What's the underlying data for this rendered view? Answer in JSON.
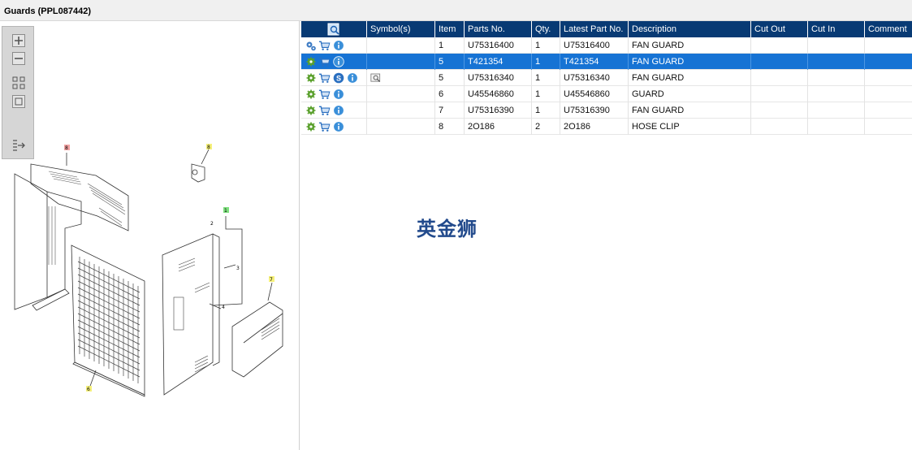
{
  "window": {
    "title": "Guards (PPL087442)"
  },
  "zoom_toolbar": {
    "buttons": [
      "zoom-in-icon",
      "zoom-out-icon",
      "fit-all-icon",
      "fit-page-icon",
      "export-list-icon"
    ]
  },
  "drawing": {
    "callouts": [
      "8",
      "8",
      "1",
      "2",
      "3",
      "4",
      "7",
      "6"
    ]
  },
  "grid": {
    "columns": [
      "",
      "Symbol(s)",
      "Item",
      "Parts No.",
      "Qty.",
      "Latest Part No.",
      "Description",
      "Cut Out",
      "Cut In",
      "Comment"
    ],
    "rows": [
      {
        "item": "1",
        "parts_no": "U75316400",
        "qty": "1",
        "latest": "U75316400",
        "description": "FAN GUARD",
        "cut_out": "",
        "cut_in": "",
        "comment": "",
        "selected": false,
        "has_s": false,
        "has_symbol": false
      },
      {
        "item": "5",
        "parts_no": "T421354",
        "qty": "1",
        "latest": "T421354",
        "description": "FAN GUARD",
        "cut_out": "",
        "cut_in": "",
        "comment": "",
        "selected": true,
        "has_s": false,
        "has_symbol": false
      },
      {
        "item": "5",
        "parts_no": "U75316340",
        "qty": "1",
        "latest": "U75316340",
        "description": "FAN GUARD",
        "cut_out": "",
        "cut_in": "",
        "comment": "",
        "selected": false,
        "has_s": true,
        "has_symbol": true
      },
      {
        "item": "6",
        "parts_no": "U45546860",
        "qty": "1",
        "latest": "U45546860",
        "description": "GUARD",
        "cut_out": "",
        "cut_in": "",
        "comment": "",
        "selected": false,
        "has_s": false,
        "has_symbol": false
      },
      {
        "item": "7",
        "parts_no": "U75316390",
        "qty": "1",
        "latest": "U75316390",
        "description": "FAN GUARD",
        "cut_out": "",
        "cut_in": "",
        "comment": "",
        "selected": false,
        "has_s": false,
        "has_symbol": false
      },
      {
        "item": "8",
        "parts_no": "2O186",
        "qty": "2",
        "latest": "2O186",
        "description": "HOSE CLIP",
        "cut_out": "",
        "cut_in": "",
        "comment": "",
        "selected": false,
        "has_s": false,
        "has_symbol": false
      }
    ]
  },
  "watermark": "英金狮",
  "colors": {
    "header": "#083a74",
    "selected_row": "#1673d4",
    "info_icon": "#3a8fd9",
    "gear_icon": "#5aa02c"
  }
}
